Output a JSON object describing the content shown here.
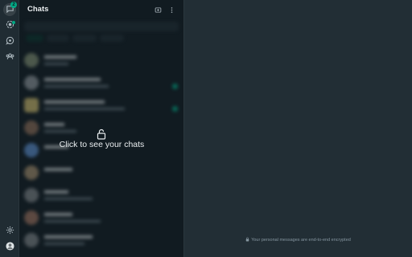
{
  "rail": {
    "chats_badge": "2",
    "items": [
      {
        "icon": "chats-icon"
      },
      {
        "icon": "status-icon"
      },
      {
        "icon": "channels-icon"
      },
      {
        "icon": "communities-icon"
      }
    ],
    "bottom": [
      {
        "icon": "settings-icon"
      },
      {
        "icon": "profile-avatar"
      }
    ]
  },
  "panel": {
    "title": "Chats",
    "new_chat_icon": "new-chat-icon",
    "menu_icon": "menu-icon"
  },
  "locked": {
    "icon": "unlock-icon",
    "label": "Click to see your chats"
  },
  "main": {
    "encryption_notice": "Your personal messages are end-to-end encrypted",
    "encryption_icon": "lock-icon"
  },
  "colors": {
    "accent": "#00a884",
    "panel_bg": "#111b21",
    "main_bg": "#222e35",
    "rail_bg": "#202c33",
    "text_primary": "#e9edef",
    "text_secondary": "#8696a0"
  }
}
